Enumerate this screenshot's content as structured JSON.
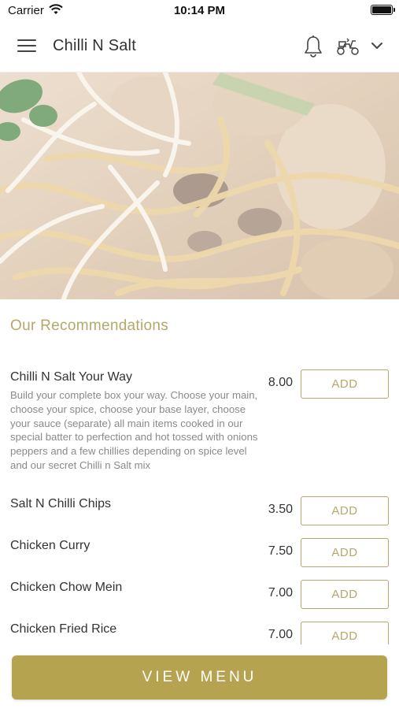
{
  "status_bar": {
    "carrier": "Carrier",
    "time": "10:14 PM"
  },
  "header": {
    "title": "Chilli N Salt"
  },
  "hero": {
    "image": "noodles-dish-photo"
  },
  "recommendations": {
    "title": "Our Recommendations",
    "items": [
      {
        "name": "Chilli N Salt Your Way",
        "description": "Build your complete box your way.  Choose your main, choose your spice, choose your base layer, choose your sauce (separate) all main items cooked in our special batter to perfection and hot tossed with onions peppers and a few chillies depending on spice level and our secret Chilli n Salt mix",
        "price": "8.00",
        "add_label": "ADD"
      },
      {
        "name": "Salt N Chilli Chips",
        "price": "3.50",
        "add_label": "ADD"
      },
      {
        "name": "Chicken Curry",
        "price": "7.50",
        "add_label": "ADD"
      },
      {
        "name": "Chicken Chow Mein",
        "price": "7.00",
        "add_label": "ADD"
      },
      {
        "name": "Chicken Fried Rice",
        "price": "7.00",
        "add_label": "ADD"
      }
    ]
  },
  "footer": {
    "view_menu_label": "VIEW MENU"
  },
  "colors": {
    "accent": "#b5a86a",
    "button_fill": "#b5a350"
  },
  "icons": [
    "wifi-icon",
    "battery-icon",
    "hamburger-menu-icon",
    "bell-icon",
    "scooter-icon",
    "chevron-down-icon"
  ]
}
